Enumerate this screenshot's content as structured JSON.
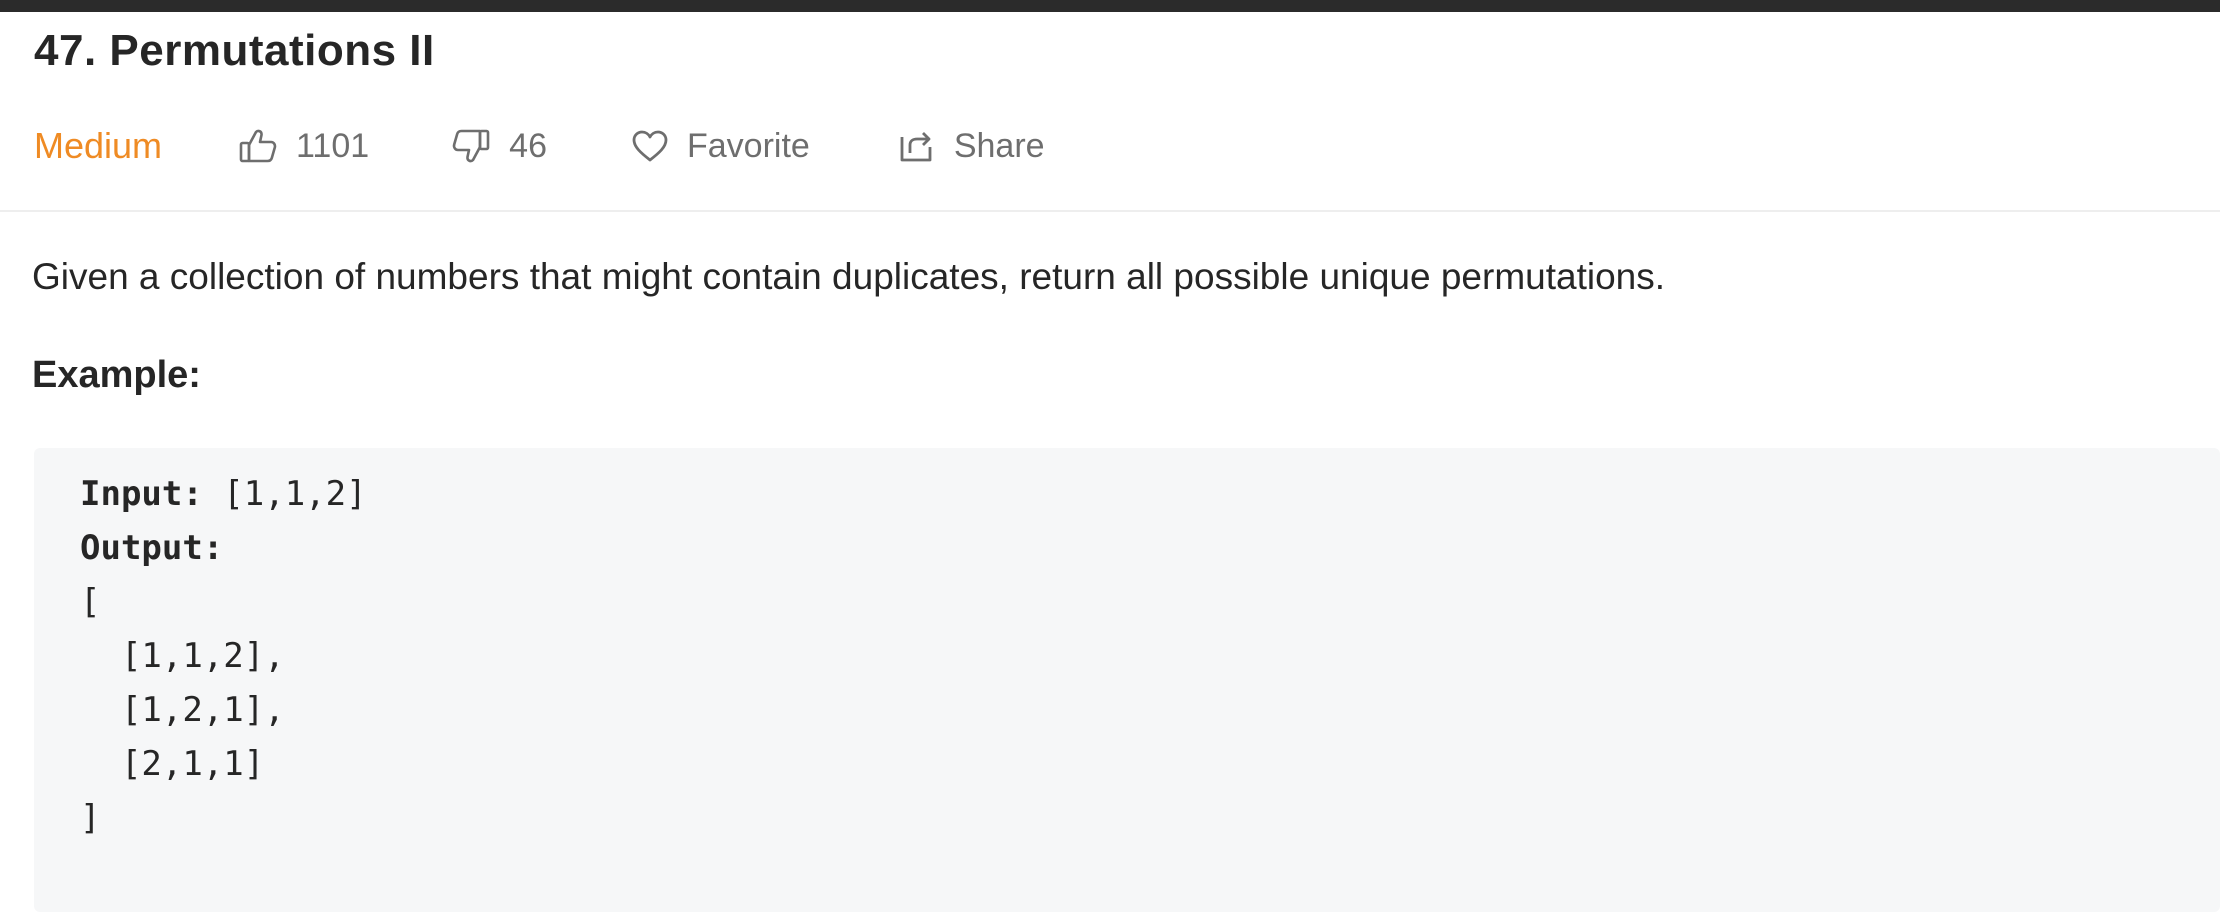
{
  "problem": {
    "number_title": "47. Permutations II",
    "difficulty": "Medium",
    "likes": "1101",
    "dislikes": "46",
    "favorite_label": "Favorite",
    "share_label": "Share",
    "description": "Given a collection of numbers that might contain duplicates, return all possible unique permutations.",
    "example_heading": "Example:"
  },
  "example": {
    "input_label": "Input:",
    "input_value": " [1,1,2]",
    "output_label": "Output:",
    "lines": [
      "[",
      "  [1,1,2],",
      "  [1,2,1],",
      "  [2,1,1]",
      "]"
    ]
  },
  "icons": {
    "likes": "thumbs-up-icon",
    "dislikes": "thumbs-down-icon",
    "favorite": "heart-icon",
    "share": "share-icon"
  },
  "colors": {
    "difficulty_medium": "#ef8b24",
    "text": "#262626",
    "muted": "#6e6e6e",
    "code_background": "#f6f7f8"
  }
}
